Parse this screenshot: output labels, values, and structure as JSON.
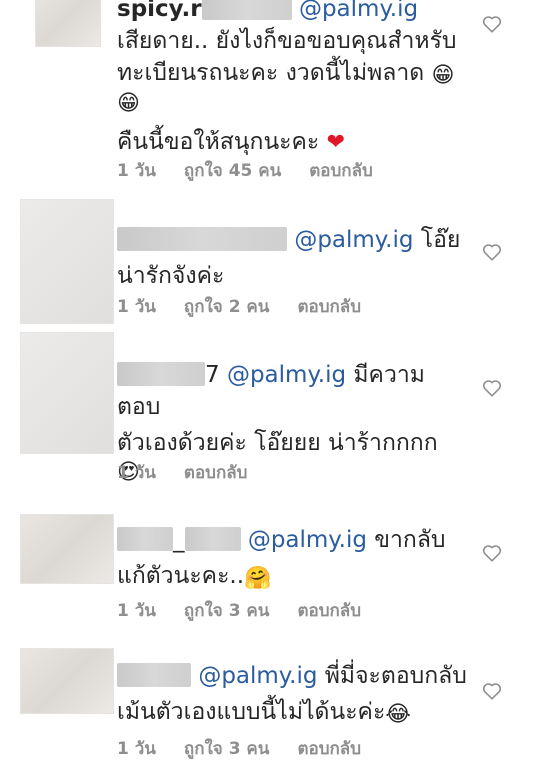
{
  "comments": [
    {
      "username_visible": "spicy.r",
      "mention": "@palmy.ig",
      "text_lines": [
        "เสียดาย.. ยังไงก็ขอขอบคุณสำหรับ",
        "ทะเบียนรถนะคะ งวดนี้ไม่พลาด"
      ],
      "emoji_inline": "😁",
      "emoji_line": "😁",
      "text_line_2": "คืนนี้ขอให้สนุกนะคะ",
      "emoji_end": "❤",
      "time": "1 วัน",
      "likes": "ถูกใจ 45 คน",
      "reply": "ตอบกลับ"
    },
    {
      "mention": "@palmy.ig",
      "text_after": "โอ๊ย",
      "text_line_2": "น่ารักจังค่ะ",
      "time": "1 วัน",
      "likes": "ถูกใจ 2 คน",
      "reply": "ตอบกลับ"
    },
    {
      "username_visible": "7",
      "mention": "@palmy.ig",
      "text_after": "มีความตอบ",
      "text_line_2": "ตัวเองด้วยค่ะ โอ๊ยยย น่าร้ากกกก",
      "emoji_line": "😍",
      "time": "1 วัน",
      "reply": "ตอบกลับ"
    },
    {
      "username_visible": "_",
      "mention": "@palmy.ig",
      "text_after": "ขากลับ",
      "text_line_2": "แก้ตัวนะคะ..",
      "emoji_end": "🤗",
      "time": "1 วัน",
      "likes": "ถูกใจ 3 คน",
      "reply": "ตอบกลับ"
    },
    {
      "mention": "@palmy.ig",
      "text_after": "พี่มี่จะตอบกลับ",
      "text_line_2": "เม้นตัวเองแบบนี้ไม่ได้นะค่ะ",
      "emoji_end": "😂",
      "time": "1 วัน",
      "likes": "ถูกใจ 3 คน",
      "reply": "ตอบกลับ"
    }
  ]
}
